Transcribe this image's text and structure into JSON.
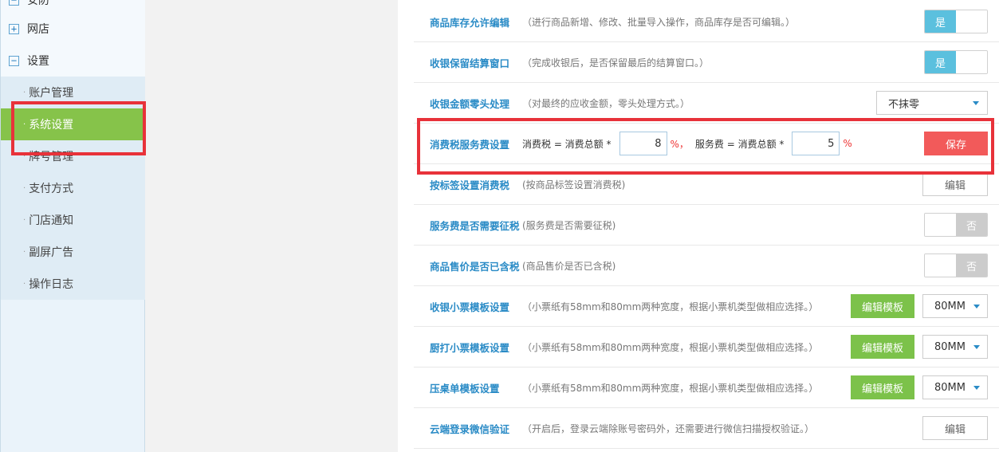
{
  "sidebar": {
    "top": [
      {
        "icon": "minus",
        "label": "安防"
      },
      {
        "icon": "plus",
        "label": "网店"
      },
      {
        "icon": "minus",
        "label": "设置"
      }
    ],
    "items": [
      {
        "label": "账户管理"
      },
      {
        "label": "系统设置"
      },
      {
        "label": "牌号管理"
      },
      {
        "label": "支付方式"
      },
      {
        "label": "门店通知"
      },
      {
        "label": "副屏广告"
      },
      {
        "label": "操作日志"
      }
    ]
  },
  "rows": {
    "stock_edit": {
      "name": "商品库存允许编辑",
      "desc": "（进行商品新增、修改、批量导入操作，商品库存是否可编辑。）",
      "toggle": "是"
    },
    "keep_window": {
      "name": "收银保留结算窗口",
      "desc": "（完成收银后，是否保留最后的结算窗口。）",
      "toggle": "是"
    },
    "rounding": {
      "name": "收银金额零头处理",
      "desc": "（对最终的应收金额，零头处理方式。）",
      "select": "不抹零"
    },
    "tax_service": {
      "name": "消费税服务费设置",
      "tax_label": "消费税 = 消费总额 *",
      "tax_value": "8",
      "pct1": "%，",
      "service_label": "服务费 = 消费总额 *",
      "service_value": "5",
      "pct2": "%",
      "save": "保存"
    },
    "tag_tax": {
      "name": "按标签设置消费税",
      "desc": "(按商品标签设置消费税)",
      "button": "编辑"
    },
    "service_taxable": {
      "name": "服务费是否需要征税",
      "desc": "(服务费是否需要征税)",
      "toggle": "否"
    },
    "price_tax": {
      "name": "商品售价是否已含税",
      "desc": "(商品售价是否已含税)",
      "toggle": "否"
    },
    "receipt_tpl": {
      "name": "收银小票模板设置",
      "desc": "（小票纸有58mm和80mm两种宽度，根据小票机类型做相应选择。）",
      "button": "编辑模板",
      "select": "80MM"
    },
    "kitchen_tpl": {
      "name": "厨打小票模板设置",
      "desc": "（小票纸有58mm和80mm两种宽度，根据小票机类型做相应选择。）",
      "button": "编辑模板",
      "select": "80MM"
    },
    "table_tpl": {
      "name": "压桌单模板设置",
      "desc": "（小票纸有58mm和80mm两种宽度，根据小票机类型做相应选择。）",
      "button": "编辑模板",
      "select": "80MM"
    },
    "wechat_verify": {
      "name": "云端登录微信验证",
      "desc": "（开启后，登录云端除账号密码外，还需要进行微信扫描授权验证。）",
      "button": "编辑"
    }
  },
  "colors": {
    "accent_blue": "#2a8bc6",
    "active_green": "#86c34a",
    "toggle_on": "#5bc0de",
    "save_red": "#f25a5a",
    "highlight_red": "#e8323a"
  }
}
